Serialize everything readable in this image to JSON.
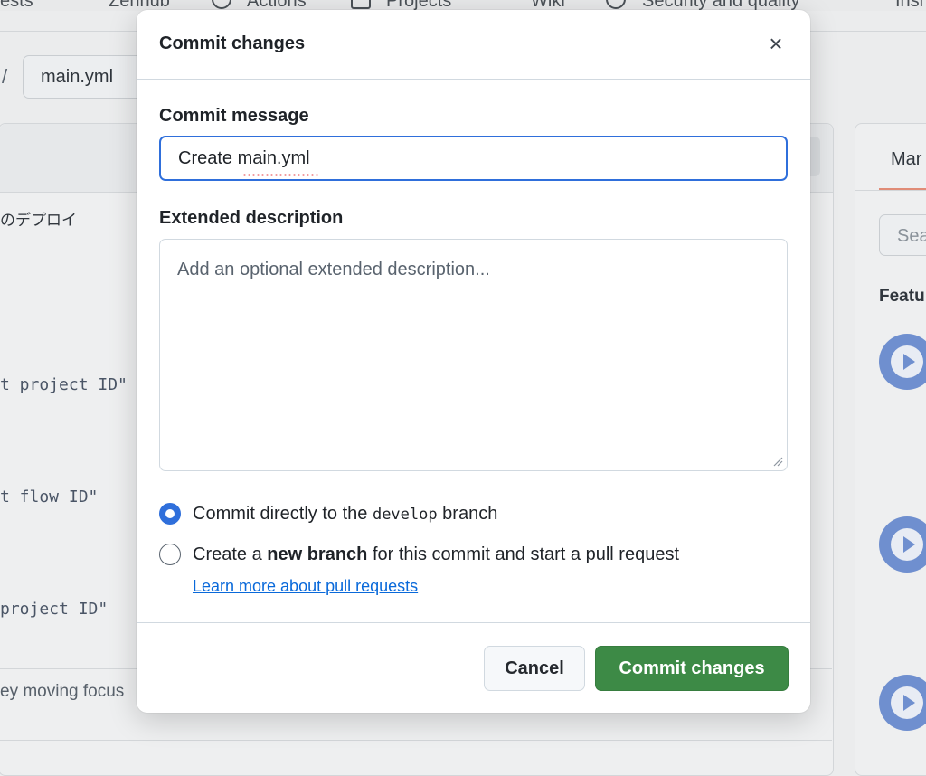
{
  "background": {
    "nav_items": [
      "ests",
      "Zenhub",
      "Actions",
      "Projects",
      "Wiki",
      "Security and quality",
      "Insi"
    ],
    "breadcrumb_slash": "/",
    "breadcrumb_file": "main.yml",
    "code_comment_jp": "のデプロイ",
    "code_lines": [
      "t project ID\"",
      "t flow ID\"",
      " project ID\""
    ],
    "focus_tip": "ey moving focus",
    "side_tab": "Mar",
    "side_search_placeholder": "Sea",
    "side_heading": "Featu"
  },
  "modal": {
    "title": "Commit changes",
    "close_label": "×",
    "commit_message_label": "Commit message",
    "commit_message_value": "Create main.yml",
    "extended_description_label": "Extended description",
    "extended_description_placeholder": "Add an optional extended description...",
    "options": {
      "direct_prefix": "Commit directly to the ",
      "direct_branch": "develop",
      "direct_suffix": " branch",
      "new_prefix": "Create a ",
      "new_bold": "new branch",
      "new_suffix": " for this commit and start a pull request",
      "selected": "direct"
    },
    "learn_more_link": "Learn more about pull requests",
    "cancel_label": "Cancel",
    "commit_label": "Commit changes"
  },
  "colors": {
    "primary_button": "#3d8a46",
    "focus_blue": "#2f6fdb",
    "link": "#0969da"
  }
}
